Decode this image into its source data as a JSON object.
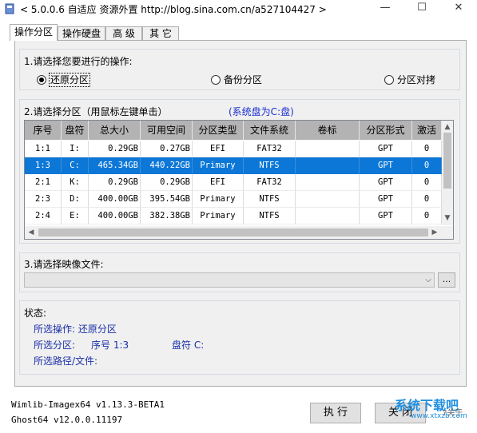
{
  "window": {
    "title": "< 5.0.0.6 自适应 资源外置 http://blog.sina.com.cn/a527104427 >",
    "min_glyph": "—",
    "max_glyph": "☐",
    "close_glyph": "✕"
  },
  "tabs": [
    "操作分区",
    "操作硬盘",
    "高 级",
    "其 它"
  ],
  "operation": {
    "label": "1.请选择您要进行的操作:",
    "options": [
      {
        "label": "还原分区",
        "selected": true
      },
      {
        "label": "备份分区",
        "selected": false
      },
      {
        "label": "分区对拷",
        "selected": false
      }
    ]
  },
  "partition": {
    "label": "2.请选择分区（用鼠标左键单击）",
    "system_note": "(系统盘为C:盘)",
    "columns": [
      "序号",
      "盘符",
      "总大小",
      "可用空间",
      "分区类型",
      "文件系统",
      "卷标",
      "分区形式",
      "激活"
    ],
    "rows": [
      [
        "1:1",
        "I:",
        "0.29GB",
        "0.27GB",
        "EFI",
        "FAT32",
        "",
        "GPT",
        "0"
      ],
      [
        "1:3",
        "C:",
        "465.34GB",
        "440.22GB",
        "Primary",
        "NTFS",
        "",
        "GPT",
        "0"
      ],
      [
        "2:1",
        "K:",
        "0.29GB",
        "0.29GB",
        "EFI",
        "FAT32",
        "",
        "GPT",
        "0"
      ],
      [
        "2:3",
        "D:",
        "400.00GB",
        "395.54GB",
        "Primary",
        "NTFS",
        "",
        "GPT",
        "0"
      ],
      [
        "2:4",
        "E:",
        "400.00GB",
        "382.38GB",
        "Primary",
        "NTFS",
        "",
        "GPT",
        "0"
      ]
    ],
    "selected_row": 1,
    "scroll_up": "▲",
    "scroll_down": "▼",
    "scroll_left": "◀",
    "scroll_right": "▶"
  },
  "image_file": {
    "label": "3.请选择映像文件:",
    "value": "",
    "combo_arrow": "⌵",
    "browse_label": "..."
  },
  "status": {
    "label": "状态:",
    "op_line": "所选操作: 还原分区",
    "part_prefix": "所选分区:",
    "part_index": "序号 1:3",
    "part_drive": "盘符 C:",
    "path_line": "所选路径/文件:"
  },
  "footer": {
    "wimlib": "Wimlib-Imagex64 v1.13.3-BETA1",
    "ghost": "Ghost64 v12.0.0.11197",
    "run_label": "执 行",
    "close_label": "关 闭"
  },
  "watermark": {
    "text": "系统下载吧",
    "url": "www.xtxzb.com",
    "about": "?关于"
  },
  "colors": {
    "selected_row": "#0c77d6",
    "header": "#b3b3b3",
    "status_text": "#1a2fa8",
    "watermark": "#1f8fe0"
  }
}
